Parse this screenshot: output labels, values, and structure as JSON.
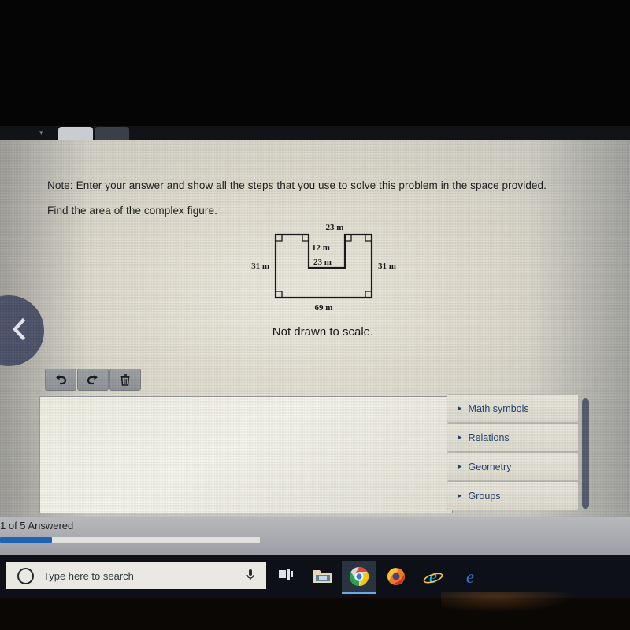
{
  "question": {
    "note": "Note: Enter your answer and show all the steps that you use to solve this problem in the space provided.",
    "prompt": "Find the area of the complex figure.",
    "caption": "Not drawn to scale."
  },
  "figure": {
    "name": "complex-figure",
    "shape": "rectangle-with-rectangular-notch",
    "labels": {
      "top_right": "23 m",
      "notch_vertical": "12 m",
      "notch_horizontal": "23 m",
      "left_side": "31 m",
      "right_side": "31 m",
      "bottom": "69 m"
    }
  },
  "toolbar": {
    "undo_icon": "undo-arrow-icon",
    "redo_icon": "redo-arrow-icon",
    "delete_icon": "trash-can-icon"
  },
  "answer_area": {
    "value": "",
    "placeholder": ""
  },
  "symbol_panel": {
    "items": [
      {
        "label": "Math symbols",
        "caret": "▸"
      },
      {
        "label": "Relations",
        "caret": "▸"
      },
      {
        "label": "Geometry",
        "caret": "▸"
      },
      {
        "label": "Groups",
        "caret": "▸"
      }
    ]
  },
  "navigation": {
    "previous_icon": "chevron-left-icon"
  },
  "status": {
    "answered_text": "1 of 5 Answered",
    "answered_count": 1,
    "total_count": 5,
    "progress_percent": 20,
    "progress_color": "#1f63b5"
  },
  "taskbar": {
    "search_placeholder": "Type here to search",
    "cortana_icon": "cortana-circle-icon",
    "mic_icon": "microphone-icon",
    "taskview_icon": "task-view-icon",
    "apps": [
      {
        "name": "file-explorer",
        "active": false
      },
      {
        "name": "google-chrome",
        "active": true
      },
      {
        "name": "mozilla-firefox",
        "active": false
      },
      {
        "name": "internet-explorer",
        "active": false
      },
      {
        "name": "microsoft-edge",
        "active": false
      }
    ]
  }
}
